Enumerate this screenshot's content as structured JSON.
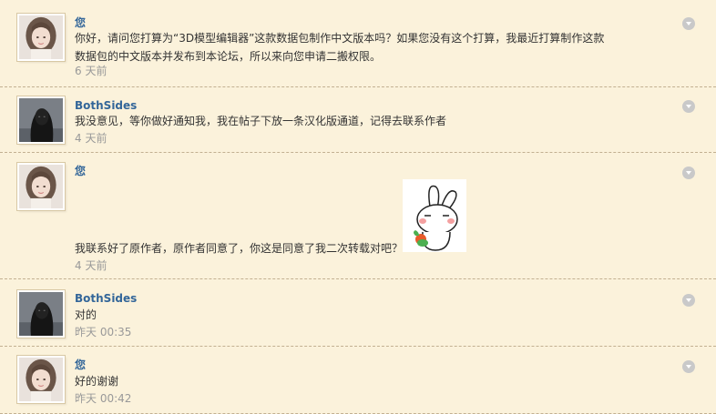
{
  "messages": [
    {
      "author": "您",
      "text": "你好，请问您打算为“3D模型编辑器”这款数据包制作中文版本吗？如果您没有这个打算，我最近打算制作这款数据包的中文版本并发布到本论坛，所以来向您申请二搬权限。",
      "time": "6 天前",
      "avatar": "female-avatar"
    },
    {
      "author": "BothSides",
      "text": "我没意见，等你做好通知我，我在帖子下放一条汉化版通道，记得去联系作者",
      "time": "4 天前",
      "avatar": "dark-hooded-avatar"
    },
    {
      "author": "您",
      "text": "我联系好了原作者，原作者同意了，你这是同意了我二次转载对吧？",
      "time": "4 天前",
      "avatar": "female-avatar",
      "sticker": "rabbit-sticker-icon"
    },
    {
      "author": "BothSides",
      "text": "对的",
      "time": "昨天 00:35",
      "avatar": "dark-hooded-avatar"
    },
    {
      "author": "您",
      "text": "好的谢谢",
      "time": "昨天 00:42",
      "avatar": "female-avatar"
    }
  ],
  "colors": {
    "background": "#fbf2db",
    "author": "#336699",
    "body": "#333333",
    "time": "#999999",
    "divider": "#c2b091"
  }
}
